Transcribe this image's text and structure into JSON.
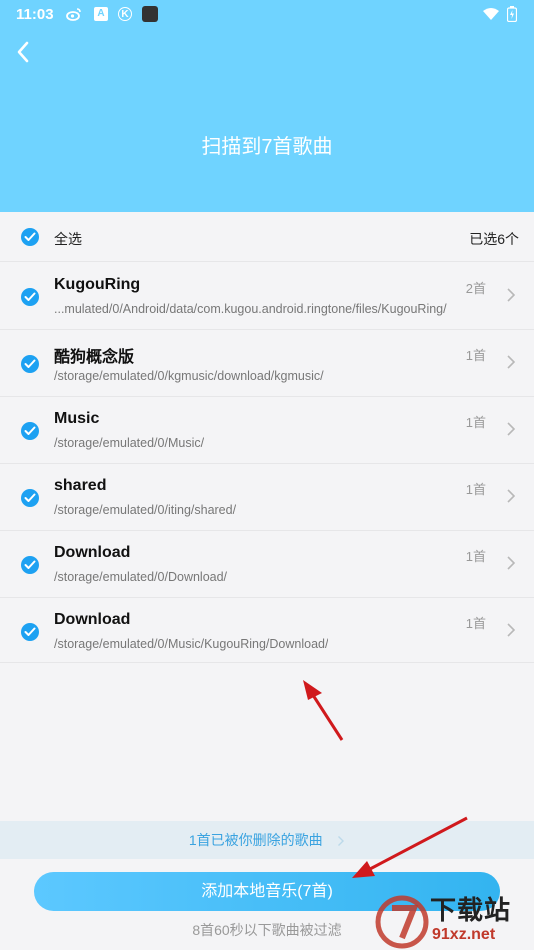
{
  "status": {
    "time": "11:03"
  },
  "header": {
    "title": "扫描到7首歌曲"
  },
  "select_all": {
    "label": "全选",
    "count": "已选6个"
  },
  "folders": [
    {
      "name": "KugouRing",
      "path": "...mulated/0/Android/data/com.kugou.android.ringtone/files/KugouRing/",
      "count": "2首"
    },
    {
      "name": "酷狗概念版",
      "path": "/storage/emulated/0/kgmusic/download/kgmusic/",
      "count": "1首"
    },
    {
      "name": "Music",
      "path": "/storage/emulated/0/Music/",
      "count": "1首"
    },
    {
      "name": "shared",
      "path": "/storage/emulated/0/iting/shared/",
      "count": "1首"
    },
    {
      "name": "Download",
      "path": "/storage/emulated/0/Download/",
      "count": "1首"
    },
    {
      "name": "Download",
      "path": "/storage/emulated/0/Music/KugouRing/Download/",
      "count": "1首"
    }
  ],
  "deleted_songs": {
    "label": "1首已被你删除的歌曲"
  },
  "add_button": {
    "label": "添加本地音乐(7首)"
  },
  "filtered_note": "8首60秒以下歌曲被过滤",
  "watermark": {
    "text": "下载站",
    "url": "91xz.net"
  },
  "colors": {
    "header": "#6fd3ff",
    "accent": "#1da1f2",
    "arrow": "#d0191c"
  }
}
